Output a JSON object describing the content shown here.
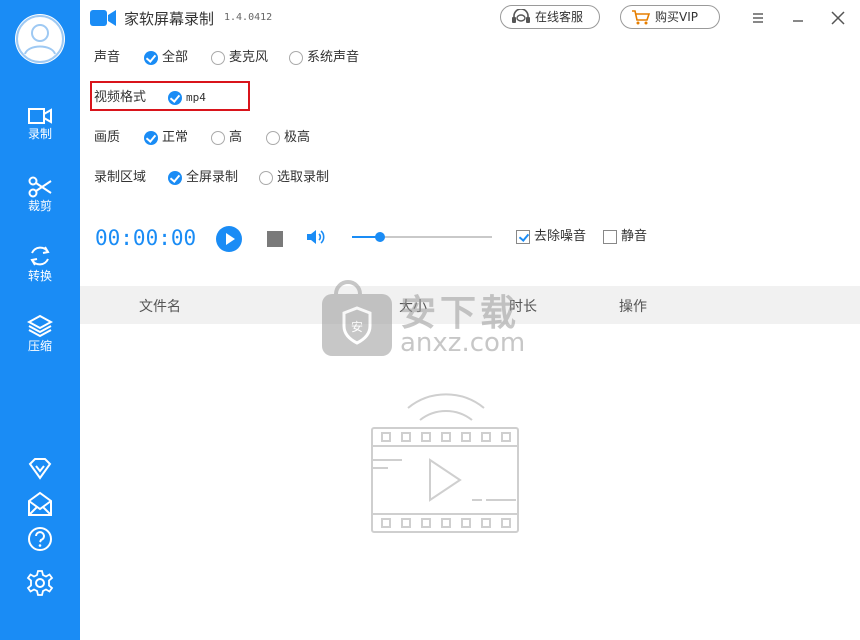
{
  "app": {
    "title": "家软屏幕录制",
    "version": "1.4.0412",
    "accent": "#1a8cf5",
    "highlight_border": "#d9141b"
  },
  "titlebar": {
    "support_label": "在线客服",
    "support_icon": "headset-icon",
    "vip_label": "购买VIP",
    "vip_icon": "cart-icon"
  },
  "sidebar": {
    "items": [
      {
        "label": "录制",
        "icon": "video-camera-icon"
      },
      {
        "label": "裁剪",
        "icon": "scissors-icon"
      },
      {
        "label": "转换",
        "icon": "refresh-icon"
      },
      {
        "label": "压缩",
        "icon": "layers-icon"
      }
    ],
    "bottom_icons": [
      "vip-diamond-icon",
      "mail-icon",
      "help-icon",
      "gear-icon"
    ]
  },
  "settings": {
    "sound": {
      "label": "声音",
      "options": [
        "全部",
        "麦克风",
        "系统声音"
      ],
      "selected": "全部"
    },
    "format": {
      "label": "视频格式",
      "options": [
        "mp4"
      ],
      "selected": "mp4"
    },
    "quality": {
      "label": "画质",
      "options": [
        "正常",
        "高",
        "极高"
      ],
      "selected": "正常"
    },
    "region": {
      "label": "录制区域",
      "options": [
        "全屏录制",
        "选取录制"
      ],
      "selected": "全屏录制"
    }
  },
  "controls": {
    "timer": "00:00:00",
    "volume_level": 0.2,
    "denoise": {
      "label": "去除噪音",
      "checked": true
    },
    "mute": {
      "label": "静音",
      "checked": false
    }
  },
  "table": {
    "columns": [
      "文件名",
      "大小",
      "时长",
      "操作"
    ]
  },
  "watermark": {
    "cn": "安下载",
    "domain": "anxz.com"
  }
}
